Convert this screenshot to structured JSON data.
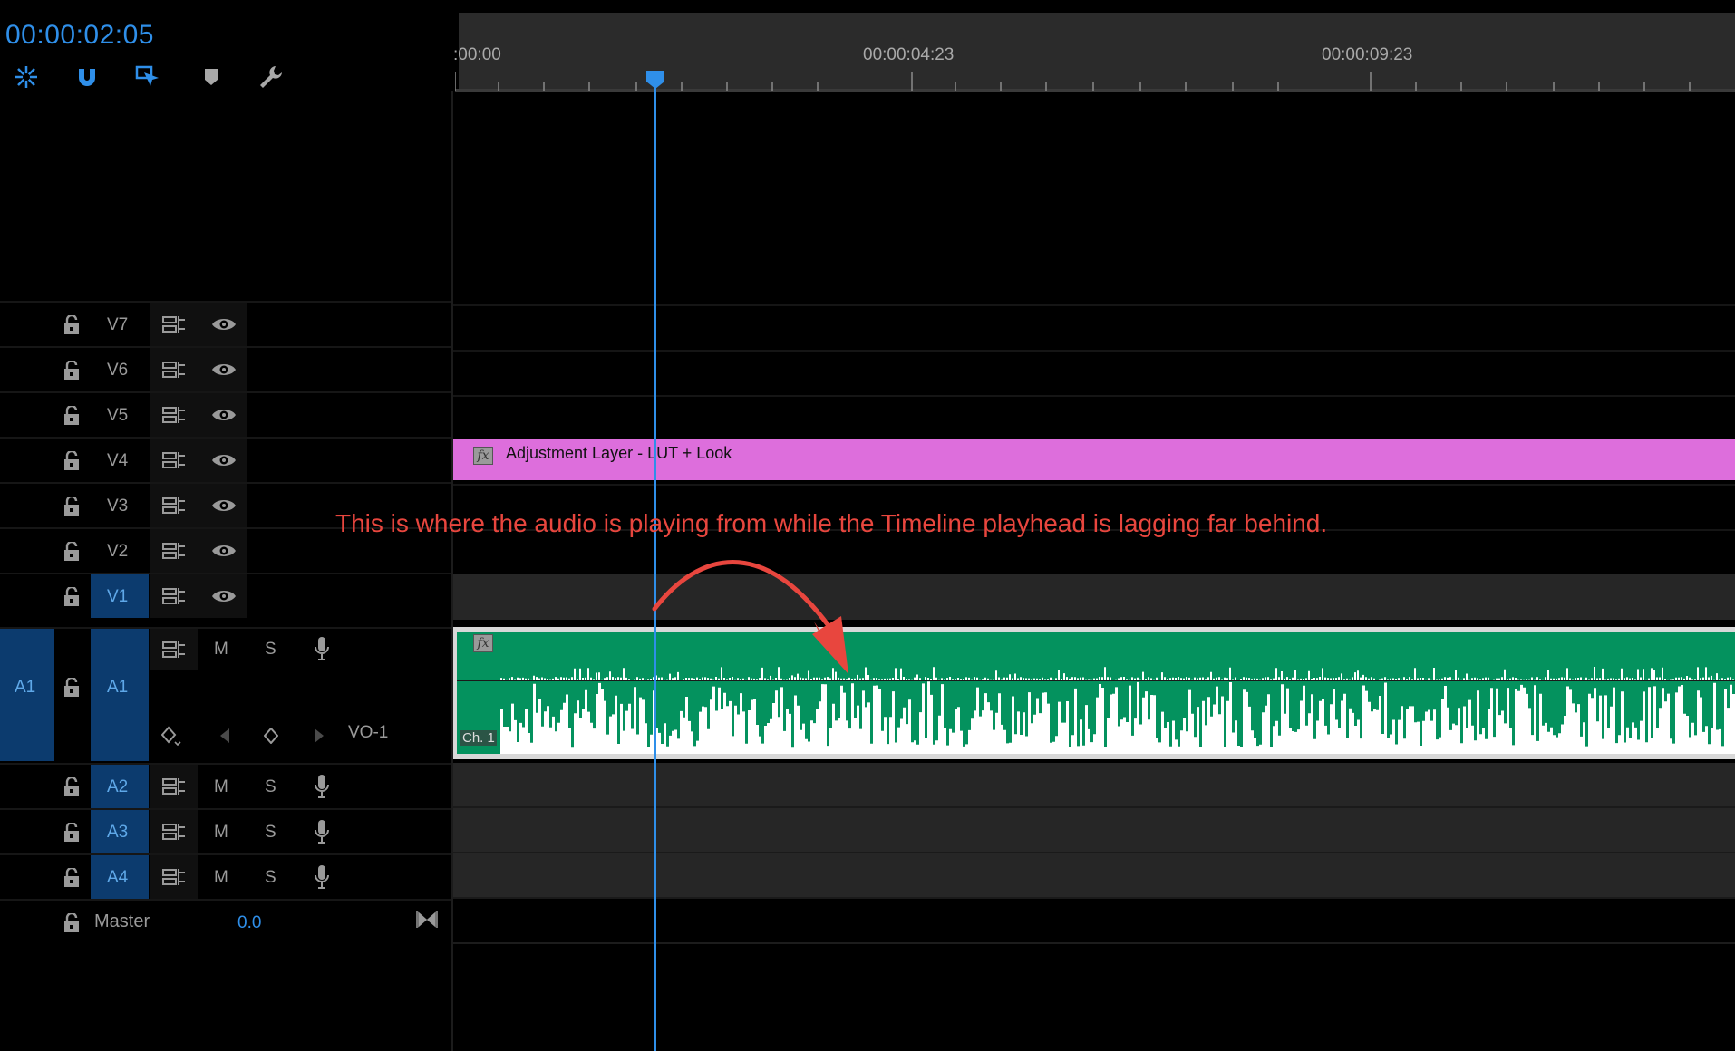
{
  "timecode": "00:00:02:05",
  "ruler": {
    "labels": [
      ":00:00",
      "00:00:04:23",
      "00:00:09:23"
    ]
  },
  "tracks": {
    "video": [
      {
        "name": "V7",
        "selected": false
      },
      {
        "name": "V6",
        "selected": false
      },
      {
        "name": "V5",
        "selected": false
      },
      {
        "name": "V4",
        "selected": false
      },
      {
        "name": "V3",
        "selected": false
      },
      {
        "name": "V2",
        "selected": false
      },
      {
        "name": "V1",
        "selected": true
      }
    ],
    "a1": {
      "source": "A1",
      "target": "A1",
      "mute": "M",
      "solo": "S",
      "clip_name": "VO-1"
    },
    "audio": [
      {
        "name": "A2",
        "mute": "M",
        "solo": "S"
      },
      {
        "name": "A3",
        "mute": "M",
        "solo": "S"
      },
      {
        "name": "A4",
        "mute": "M",
        "solo": "S"
      }
    ],
    "master": {
      "label": "Master",
      "value": "0.0"
    }
  },
  "clips": {
    "adjustment_layer": {
      "label": "Adjustment Layer - LUT + Look",
      "fx": "fx",
      "color": "#dd6edc"
    },
    "audio": {
      "fx": "fx",
      "channel": "Ch. 1",
      "color": "#04925e"
    }
  },
  "annotation": "This is where the audio is playing from while the Timeline playhead is lagging far behind.",
  "colors": {
    "accent": "#2f8fe9",
    "annotation": "#e8463e"
  }
}
